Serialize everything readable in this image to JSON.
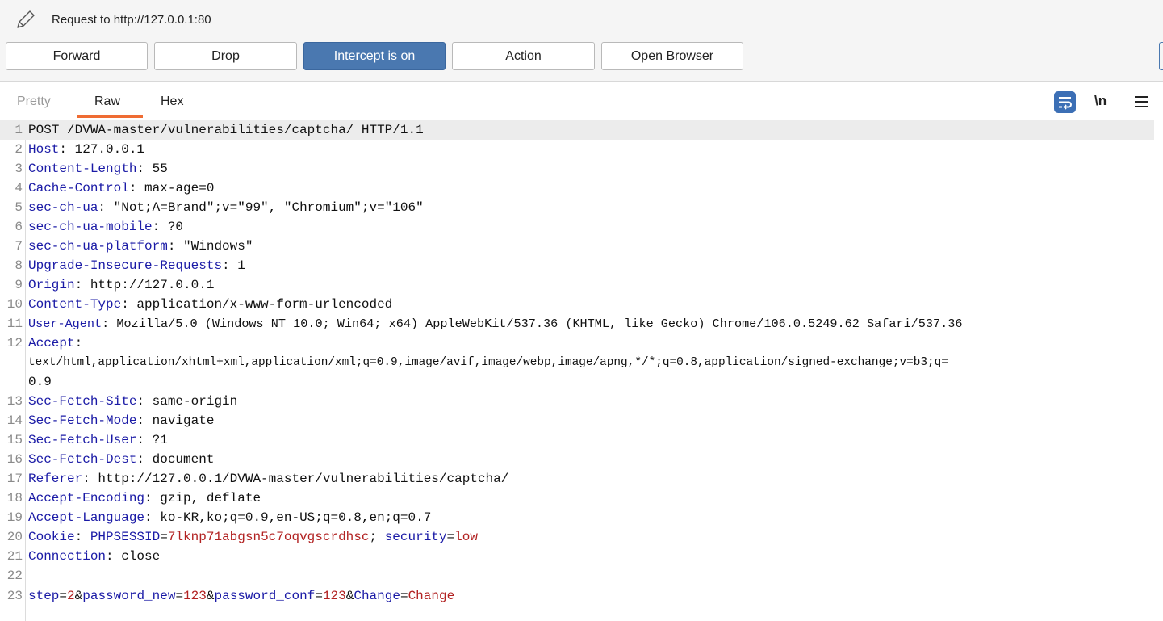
{
  "header": {
    "title": "Request to http://127.0.0.1:80",
    "buttons": {
      "forward": "Forward",
      "drop": "Drop",
      "intercept": "Intercept is on",
      "action": "Action",
      "open_browser": "Open Browser"
    }
  },
  "tabs": {
    "pretty": "Pretty",
    "raw": "Raw",
    "hex": "Hex",
    "active": "Raw"
  },
  "toolbar": {
    "newline_label": "\\n",
    "icons": [
      "wrap-lines-icon",
      "newline-toggle",
      "menu-icon"
    ]
  },
  "colors": {
    "accent": "#4a78b0",
    "tab_underline": "#ef6c33",
    "header_name": "#1a1aa6",
    "param_value": "#b22222"
  },
  "request": {
    "lines": {
      "l1": {
        "num": "1",
        "text": "POST /DVWA-master/vulnerabilities/captcha/ HTTP/1.1"
      },
      "l2": {
        "num": "2",
        "name": "Host",
        "sep": ": ",
        "value": "127.0.0.1"
      },
      "l3": {
        "num": "3",
        "name": "Content-Length",
        "sep": ": ",
        "value": "55"
      },
      "l4": {
        "num": "4",
        "name": "Cache-Control",
        "sep": ": ",
        "value": "max-age=0"
      },
      "l5": {
        "num": "5",
        "name": "sec-ch-ua",
        "sep": ": ",
        "value": "\"Not;A=Brand\";v=\"99\", \"Chromium\";v=\"106\""
      },
      "l6": {
        "num": "6",
        "name": "sec-ch-ua-mobile",
        "sep": ": ",
        "value": "?0"
      },
      "l7": {
        "num": "7",
        "name": "sec-ch-ua-platform",
        "sep": ": ",
        "value": "\"Windows\""
      },
      "l8": {
        "num": "8",
        "name": "Upgrade-Insecure-Requests",
        "sep": ": ",
        "value": "1"
      },
      "l9": {
        "num": "9",
        "name": "Origin",
        "sep": ": ",
        "value": "http://127.0.0.1"
      },
      "l10": {
        "num": "10",
        "name": "Content-Type",
        "sep": ": ",
        "value": "application/x-www-form-urlencoded"
      },
      "l11": {
        "num": "11",
        "name": "User-Agent",
        "sep": ": ",
        "value": "Mozilla/5.0 (Windows NT 10.0; Win64; x64) AppleWebKit/537.36 (KHTML, like Gecko) Chrome/106.0.5249.62 Safari/537.36"
      },
      "l12": {
        "num": "12",
        "name": "Accept",
        "sep": ":",
        "value_1": "text/html,application/xhtml+xml,application/xml;q=0.9,image/avif,image/webp,image/apng,*/*;q=0.8,application/signed-exchange;v=b3;q=",
        "value_2": "0.9"
      },
      "l13": {
        "num": "13",
        "name": "Sec-Fetch-Site",
        "sep": ": ",
        "value": "same-origin"
      },
      "l14": {
        "num": "14",
        "name": "Sec-Fetch-Mode",
        "sep": ": ",
        "value": "navigate"
      },
      "l15": {
        "num": "15",
        "name": "Sec-Fetch-User",
        "sep": ": ",
        "value": "?1"
      },
      "l16": {
        "num": "16",
        "name": "Sec-Fetch-Dest",
        "sep": ": ",
        "value": "document"
      },
      "l17": {
        "num": "17",
        "name": "Referer",
        "sep": ": ",
        "value": "http://127.0.0.1/DVWA-master/vulnerabilities/captcha/"
      },
      "l18": {
        "num": "18",
        "name": "Accept-Encoding",
        "sep": ": ",
        "value": "gzip, deflate"
      },
      "l19": {
        "num": "19",
        "name": "Accept-Language",
        "sep": ": ",
        "value": "ko-KR,ko;q=0.9,en-US;q=0.8,en;q=0.7"
      },
      "l20": {
        "num": "20",
        "name": "Cookie",
        "sep": ": ",
        "c1_name": "PHPSESSID",
        "c1_value": "7lknp71abgsn5c7oqvgscrdhsc",
        "c_sep": "; ",
        "c2_name": "security",
        "c2_value": "low"
      },
      "l21": {
        "num": "21",
        "name": "Connection",
        "sep": ": ",
        "value": "close"
      },
      "l22": {
        "num": "22"
      },
      "l23": {
        "num": "23",
        "p1_name": "step",
        "p1_value": "2",
        "p2_name": "password_new",
        "p2_value": "123",
        "p3_name": "password_conf",
        "p3_value": "123",
        "p4_name": "Change",
        "p4_value": "Change"
      }
    }
  }
}
